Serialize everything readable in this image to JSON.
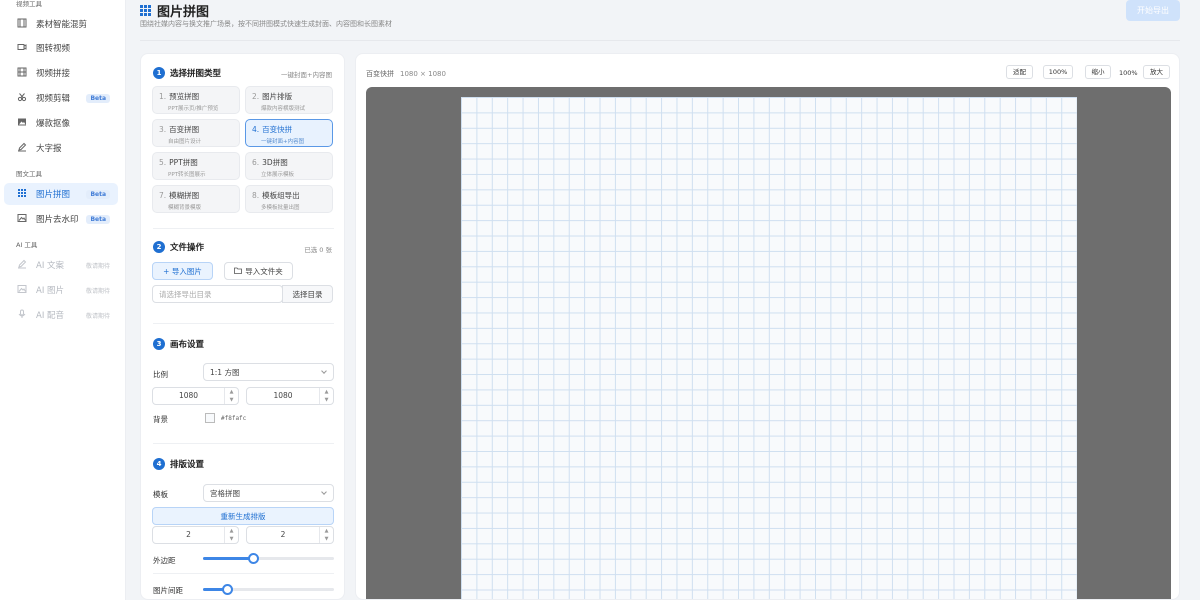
{
  "sidebar": {
    "sections": [
      {
        "title": "视频工具",
        "items": [
          {
            "label": "素材智能混剪",
            "icon": "film-icon"
          },
          {
            "label": "图转视频",
            "icon": "video-icon"
          },
          {
            "label": "视频拼接",
            "icon": "film-strip-icon"
          },
          {
            "label": "视频剪辑",
            "icon": "scissors-icon",
            "badge": "Beta"
          },
          {
            "label": "爆款抠像",
            "icon": "image-icon"
          },
          {
            "label": "大字报",
            "icon": "pen-icon"
          }
        ]
      },
      {
        "title": "图文工具",
        "items": [
          {
            "label": "图片拼图",
            "icon": "grid-icon",
            "badge": "Beta",
            "active": true
          },
          {
            "label": "图片去水印",
            "icon": "image-outline-icon",
            "badge": "Beta"
          }
        ]
      },
      {
        "title": "AI 工具",
        "items": [
          {
            "label": "AI 文案",
            "icon": "pen-icon",
            "soon": "敬请期待"
          },
          {
            "label": "AI 图片",
            "icon": "image-outline-icon",
            "soon": "敬请期待"
          },
          {
            "label": "AI 配音",
            "icon": "mic-icon",
            "soon": "敬请期待"
          }
        ]
      }
    ]
  },
  "header": {
    "title": "图片拼图",
    "subtitle": "围绕社媒内容与换文推广场景，按不同拼图模式快速生成封面、内容图和长图素材",
    "export_label": "开始导出"
  },
  "panel": {
    "sec1": {
      "num": "1",
      "title": "选择拼图类型",
      "right": "一键封面+内容图",
      "types": [
        {
          "n": "1.",
          "title": "预览拼图",
          "desc": "PPT展示页/推广预览"
        },
        {
          "n": "2.",
          "title": "图片排版",
          "desc": "爆款内容横版测试"
        },
        {
          "n": "3.",
          "title": "百变拼图",
          "desc": "自由图片设计"
        },
        {
          "n": "4.",
          "title": "百变快拼",
          "desc": "一键封面+内容图",
          "active": true
        },
        {
          "n": "5.",
          "title": "PPT拼图",
          "desc": "PPT转长图展示"
        },
        {
          "n": "6.",
          "title": "3D拼图",
          "desc": "立体展示模板"
        },
        {
          "n": "7.",
          "title": "模糊拼图",
          "desc": "模糊背景模版"
        },
        {
          "n": "8.",
          "title": "模板组导出",
          "desc": "多模板批量出图"
        }
      ]
    },
    "sec2": {
      "num": "2",
      "title": "文件操作",
      "right": "已选 0 张",
      "import_images": "+ 导入图片",
      "import_folder": "导入文件夹",
      "dir_placeholder": "请选择导出目录",
      "choose_dir": "选择目录"
    },
    "sec3": {
      "num": "3",
      "title": "画布设置",
      "ratio_label": "比例",
      "ratio_value": "1:1 方图",
      "width": "1080",
      "height": "1080",
      "bg_label": "背景",
      "bg_value": "#f8fafc"
    },
    "sec4": {
      "num": "4",
      "title": "排版设置",
      "template_label": "模板",
      "template_value": "宫格拼图",
      "regen_label": "重新生成排版",
      "cols": "2",
      "rows": "2",
      "margin_label": "外边距",
      "margin_value": 0.38,
      "gap_label": "图片间距",
      "gap_value": 0.18
    }
  },
  "preview": {
    "label": "百变快拼",
    "size": "1080 × 1080",
    "fit": "适配",
    "zoom100": "100%",
    "zoom_out": "缩小",
    "zoom_level": "100%",
    "zoom_in": "放大"
  }
}
